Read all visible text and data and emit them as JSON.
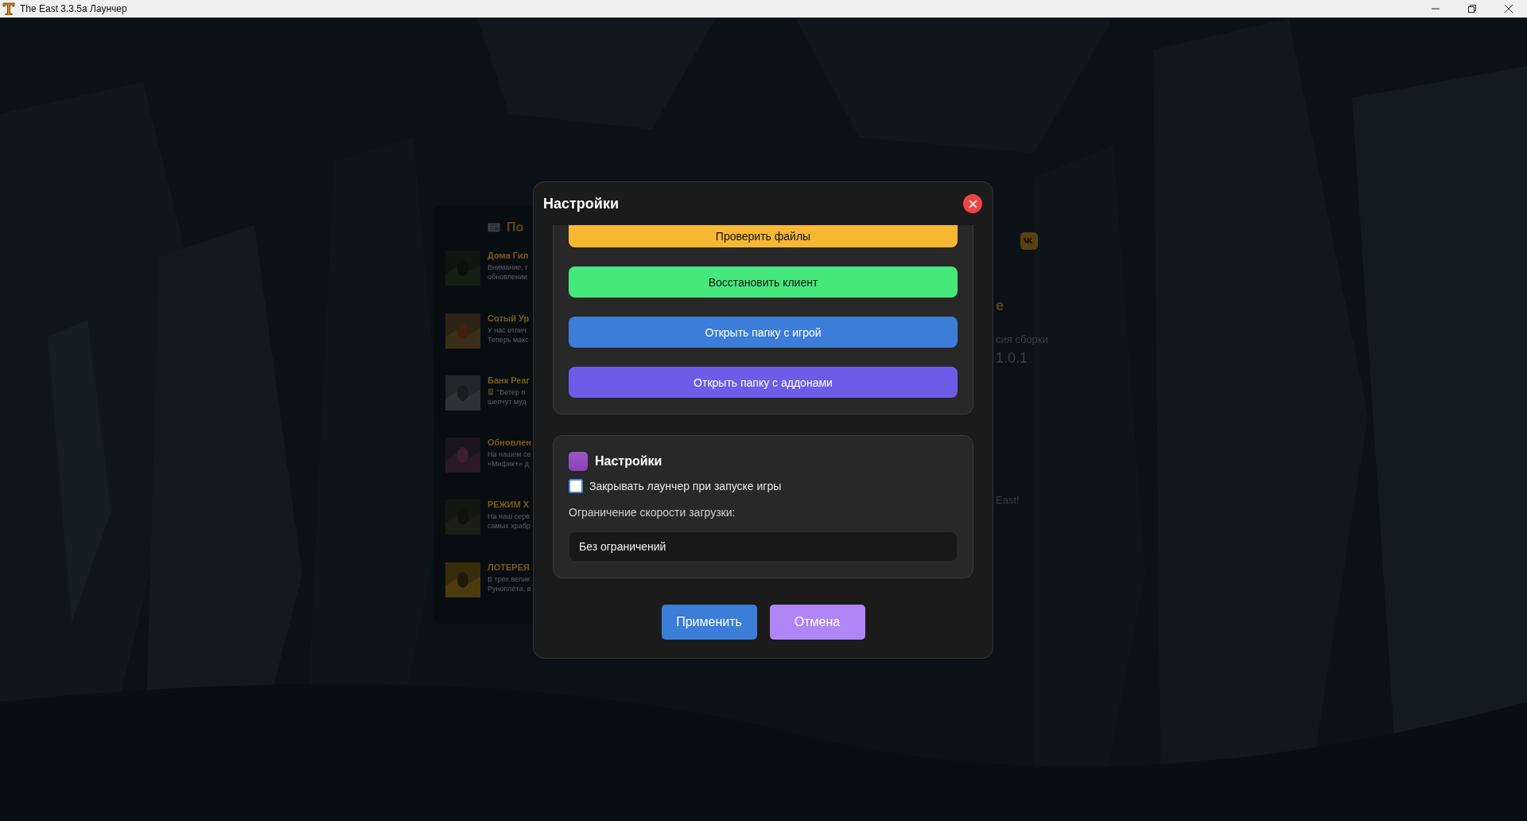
{
  "window": {
    "title": "The East 3.3.5a Лаунчер"
  },
  "background": {
    "news": {
      "header": "По",
      "items": [
        {
          "title": "Дома Гил",
          "lines": [
            "Внимание, г",
            "обновлении"
          ]
        },
        {
          "title": "Сотый Ур",
          "lines": [
            "У нас отлич",
            "Теперь макс"
          ]
        },
        {
          "title": "Банк Реаг",
          "lines": [
            "\"Ветер п",
            "шепчут муд"
          ],
          "scroll_icon": true
        },
        {
          "title": "Обновлен",
          "lines": [
            "На нашем се",
            "«Мифик+» д"
          ]
        },
        {
          "title": "РЕЖИМ Х",
          "lines": [
            "На наш серв",
            "самых храбр"
          ]
        },
        {
          "title": "ЛОТЕРЕЯ",
          "lines": [
            "В трех велик",
            "Руноплёта, в"
          ]
        }
      ]
    },
    "side": {
      "title_fragment": "е",
      "version_label": "сия сборки",
      "version": "1.0.1",
      "footer_fragment": "East!"
    }
  },
  "dialog": {
    "title": "Настройки",
    "actions": [
      {
        "label": "Проверить файлы",
        "color": "#f7b733"
      },
      {
        "label": "Восстановить клиент",
        "color": "#46e87c"
      },
      {
        "label": "Открыть папку с игрой",
        "color": "#3b7dd8"
      },
      {
        "label": "Открыть папку с аддонами",
        "color": "#6c5ce7"
      }
    ],
    "settings": {
      "title": "Настройки",
      "close_on_launch": {
        "label": "Закрывать лаунчер при запуске игры",
        "checked": false
      },
      "speed_limit": {
        "label": "Ограничение скорости загрузки:",
        "value": "Без ограничений"
      }
    },
    "buttons": [
      {
        "label": "Применить",
        "kind": "primary"
      },
      {
        "label": "Отмена",
        "kind": "secondary"
      }
    ]
  }
}
